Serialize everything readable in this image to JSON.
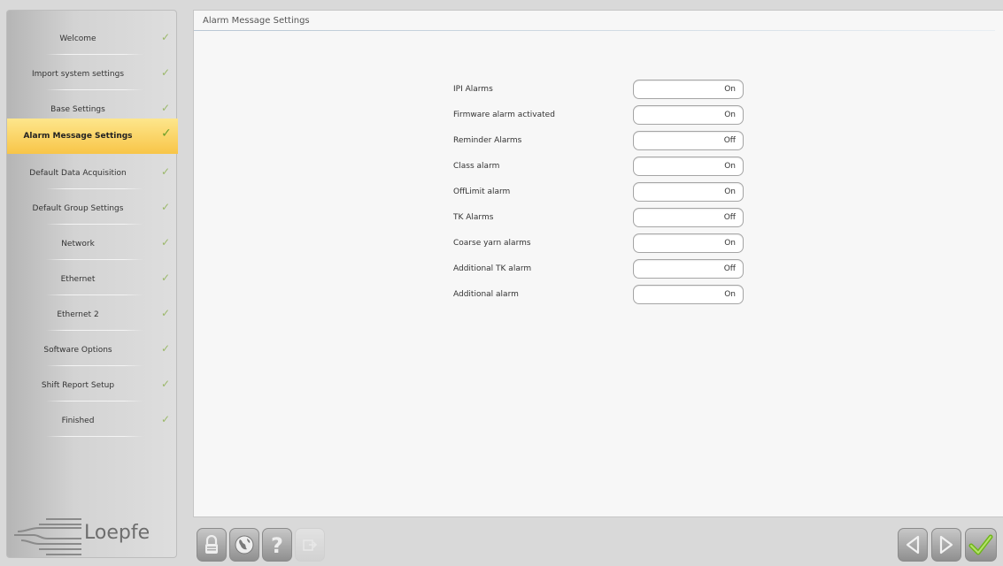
{
  "sidebar": {
    "items": [
      {
        "label": "Welcome",
        "check": "✓"
      },
      {
        "label": "Import system settings",
        "check": "✓"
      },
      {
        "label": "Base Settings",
        "check": "✓"
      },
      {
        "label": "Alarm Message Settings",
        "check": "✓",
        "active": true
      },
      {
        "label": "Default Data Acquisition",
        "check": "✓"
      },
      {
        "label": "Default Group Settings",
        "check": "✓"
      },
      {
        "label": "Network",
        "check": "✓"
      },
      {
        "label": "Ethernet",
        "check": "✓"
      },
      {
        "label": "Ethernet 2",
        "check": "✓"
      },
      {
        "label": "Software Options",
        "check": "✓"
      },
      {
        "label": "Shift Report Setup",
        "check": "✓"
      },
      {
        "label": "Finished",
        "check": "✓"
      }
    ]
  },
  "logo": {
    "text": "Loepfe"
  },
  "panel": {
    "title": "Alarm Message Settings",
    "settings": [
      {
        "label": "IPI Alarms",
        "value": "On"
      },
      {
        "label": "Firmware alarm activated",
        "value": "On"
      },
      {
        "label": "Reminder Alarms",
        "value": "Off"
      },
      {
        "label": "Class alarm",
        "value": "On"
      },
      {
        "label": "OffLimit alarm",
        "value": "On"
      },
      {
        "label": "TK Alarms",
        "value": "Off"
      },
      {
        "label": "Coarse yarn alarms",
        "value": "On"
      },
      {
        "label": "Additional TK alarm",
        "value": "Off"
      },
      {
        "label": "Additional alarm",
        "value": "On"
      }
    ]
  },
  "toolbar": {
    "left": [
      "lock-icon",
      "globe-icon",
      "help-icon",
      "export-icon"
    ],
    "right": [
      "back-arrow-icon",
      "forward-arrow-icon",
      "confirm-check-icon"
    ]
  },
  "colors": {
    "active_item": "#f8c548",
    "check_green": "#6ea02a",
    "panel_bg": "#f7f7f7"
  }
}
